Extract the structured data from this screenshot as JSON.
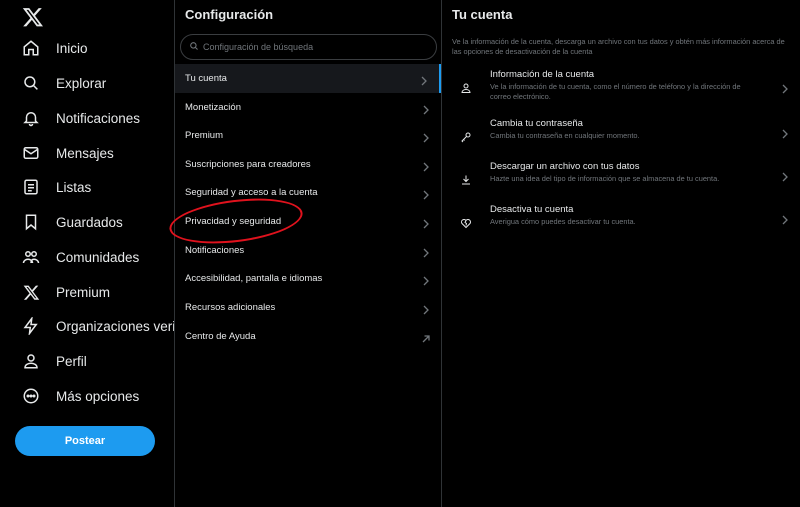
{
  "nav": {
    "logo": "x-logo-icon",
    "items": [
      {
        "label": "Inicio",
        "icon": "home-icon"
      },
      {
        "label": "Explorar",
        "icon": "search-icon"
      },
      {
        "label": "Notificaciones",
        "icon": "bell-icon"
      },
      {
        "label": "Mensajes",
        "icon": "envelope-icon"
      },
      {
        "label": "Listas",
        "icon": "list-icon"
      },
      {
        "label": "Guardados",
        "icon": "bookmark-icon"
      },
      {
        "label": "Comunidades",
        "icon": "people-icon"
      },
      {
        "label": "Premium",
        "icon": "x-logo-icon"
      },
      {
        "label": "Organizaciones verificadas",
        "icon": "lightning-icon"
      },
      {
        "label": "Perfil",
        "icon": "user-icon"
      },
      {
        "label": "Más opciones",
        "icon": "more-circle-icon"
      }
    ],
    "post_label": "Postear"
  },
  "settings": {
    "title": "Configuración",
    "search_placeholder": "Configuración de búsqueda",
    "items": [
      {
        "label": "Tu cuenta",
        "active": true,
        "icon": "chevron-right-icon"
      },
      {
        "label": "Monetización",
        "icon": "chevron-right-icon"
      },
      {
        "label": "Premium",
        "icon": "chevron-right-icon"
      },
      {
        "label": "Suscripciones para creadores",
        "icon": "chevron-right-icon"
      },
      {
        "label": "Seguridad y acceso a la cuenta",
        "icon": "chevron-right-icon"
      },
      {
        "label": "Privacidad y seguridad",
        "icon": "chevron-right-icon"
      },
      {
        "label": "Notificaciones",
        "icon": "chevron-right-icon"
      },
      {
        "label": "Accesibilidad, pantalla e idiomas",
        "icon": "chevron-right-icon"
      },
      {
        "label": "Recursos adicionales",
        "icon": "chevron-right-icon"
      },
      {
        "label": "Centro de Ayuda",
        "icon": "external-link-icon"
      }
    ]
  },
  "account": {
    "title": "Tu cuenta",
    "description": "Ve la información de la cuenta, descarga un archivo con tus datos y obtén más información acerca de las opciones de desactivación de la cuenta",
    "options": [
      {
        "title": "Información de la cuenta",
        "desc": "Ve la información de tu cuenta, como el número de teléfono y la dirección de correo electrónico.",
        "icon": "user-icon"
      },
      {
        "title": "Cambia tu contraseña",
        "desc": "Cambia tu contraseña en cualquier momento.",
        "icon": "key-icon"
      },
      {
        "title": "Descargar un archivo con tus datos",
        "desc": "Hazte una idea del tipo de información que se almacena de tu cuenta.",
        "icon": "download-icon"
      },
      {
        "title": "Desactiva tu cuenta",
        "desc": "Averigua cómo puedes desactivar tu cuenta.",
        "icon": "broken-heart-icon"
      }
    ]
  },
  "colors": {
    "accent": "#1d9bf0",
    "annotation": "#e0121d",
    "background": "#000000",
    "muted": "#71767b"
  }
}
